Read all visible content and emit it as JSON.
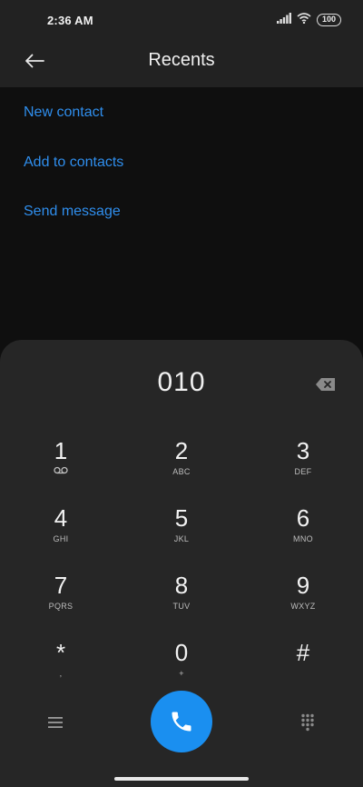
{
  "status_bar": {
    "time": "2:36 AM",
    "battery": "100",
    "icons": [
      "signal-icon",
      "wifi-icon",
      "battery-icon"
    ]
  },
  "header": {
    "title": "Recents",
    "back_icon": "arrow-left-icon"
  },
  "actions": [
    {
      "label": "New contact"
    },
    {
      "label": "Add to contacts"
    },
    {
      "label": "Send message"
    }
  ],
  "dialpad": {
    "number": "010",
    "keys": [
      {
        "digit": "1",
        "letters": ""
      },
      {
        "digit": "2",
        "letters": "ABC"
      },
      {
        "digit": "3",
        "letters": "DEF"
      },
      {
        "digit": "4",
        "letters": "GHI"
      },
      {
        "digit": "5",
        "letters": "JKL"
      },
      {
        "digit": "6",
        "letters": "MNO"
      },
      {
        "digit": "7",
        "letters": "PQRS"
      },
      {
        "digit": "8",
        "letters": "TUV"
      },
      {
        "digit": "9",
        "letters": "WXYZ"
      },
      {
        "digit": "*",
        "letters": ","
      },
      {
        "digit": "0",
        "letters": "+"
      },
      {
        "digit": "#",
        "letters": ""
      }
    ]
  },
  "colors": {
    "accent": "#2f8eed",
    "call_button": "#1a8ff0",
    "background": "#0f0f0f",
    "header": "#222222",
    "dialpad": "#262626"
  }
}
